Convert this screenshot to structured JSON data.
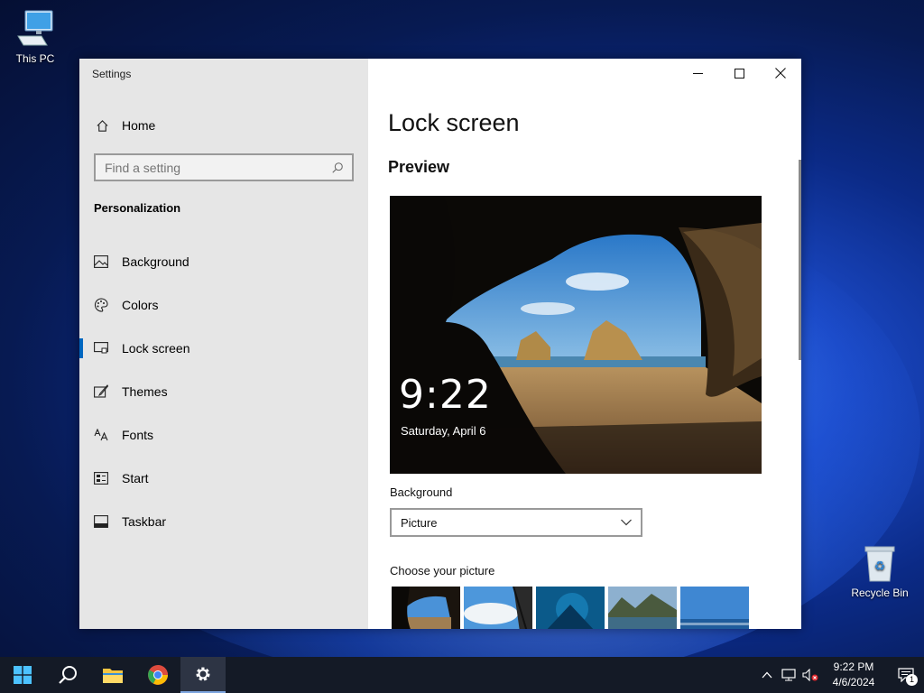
{
  "desktop": {
    "icons": [
      {
        "label": "This PC"
      },
      {
        "label": "Recycle Bin"
      }
    ]
  },
  "window": {
    "title": "Settings",
    "sidebar": {
      "home_label": "Home",
      "search_placeholder": "Find a setting",
      "section_heading": "Personalization",
      "items": [
        {
          "label": "Background",
          "icon": "image-icon"
        },
        {
          "label": "Colors",
          "icon": "palette-icon"
        },
        {
          "label": "Lock screen",
          "icon": "lock-screen-icon",
          "active": true
        },
        {
          "label": "Themes",
          "icon": "brush-icon"
        },
        {
          "label": "Fonts",
          "icon": "font-icon"
        },
        {
          "label": "Start",
          "icon": "start-menu-icon"
        },
        {
          "label": "Taskbar",
          "icon": "taskbar-icon"
        }
      ]
    },
    "content": {
      "page_title": "Lock screen",
      "preview_heading": "Preview",
      "preview_time": "9:22",
      "preview_date": "Saturday, April 6",
      "background_label": "Background",
      "background_value": "Picture",
      "choose_picture_label": "Choose your picture"
    }
  },
  "taskbar": {
    "clock_time": "9:22 PM",
    "clock_date": "4/6/2024",
    "notification_count": "1"
  },
  "colors": {
    "accent": "#0067c0",
    "sidebar_bg": "#e6e6e6",
    "taskbar_bg": "#141a26"
  }
}
